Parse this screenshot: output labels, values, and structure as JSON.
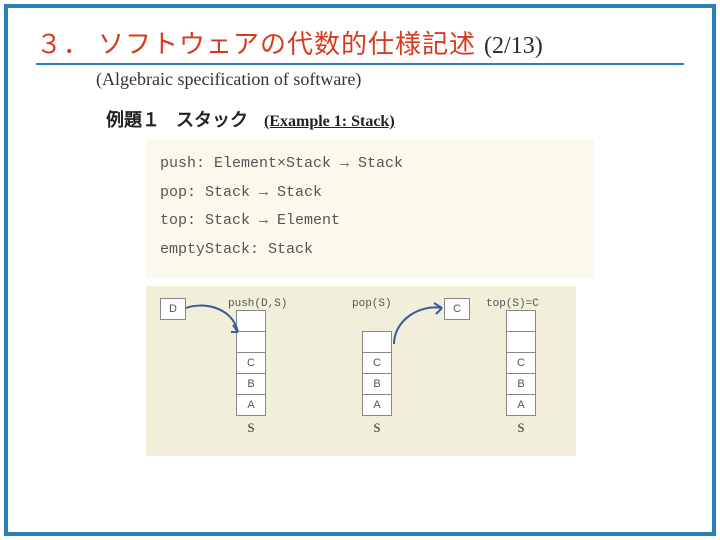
{
  "title": {
    "number": "３．",
    "main": "ソフトウェアの代数的仕様記述",
    "page": "(2/13)",
    "subtitle": "(Algebraic specification of software)"
  },
  "example": {
    "label_jp_1": "例題１",
    "label_jp_2": "スタック",
    "label_en": "(Example 1: Stack)"
  },
  "signatures": {
    "push": "push: Element×Stack → Stack",
    "pop": "pop: Stack → Stack",
    "top": "top: Stack → Element",
    "empty": "emptyStack: Stack"
  },
  "diagram": {
    "d_label": "D",
    "op_push": "push(D,S)",
    "op_pop": "pop(S)",
    "op_top": "top(S)=C",
    "c_label": "C",
    "stack1": {
      "cells": [
        "",
        "",
        "C",
        "B",
        "A"
      ],
      "label": "S"
    },
    "stack2": {
      "cells": [
        "",
        "C",
        "B",
        "A"
      ],
      "label": "S"
    },
    "stack3": {
      "cells": [
        "",
        "",
        "C",
        "B",
        "A"
      ],
      "label": "S"
    }
  }
}
